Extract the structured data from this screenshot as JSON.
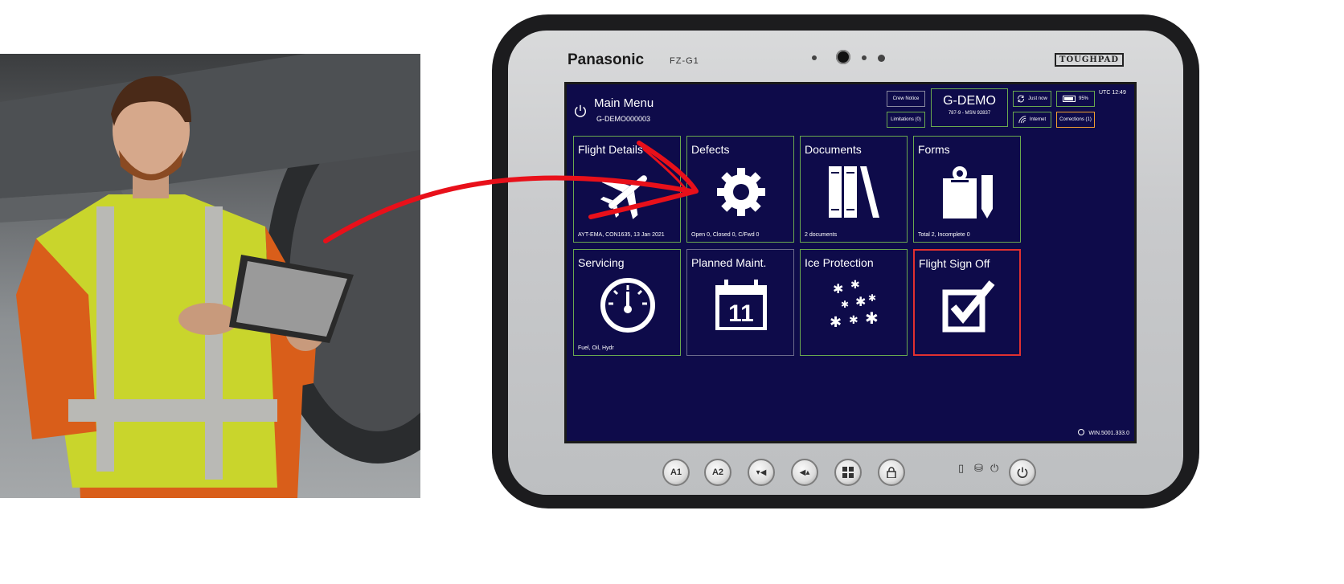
{
  "tablet": {
    "brand": "Panasonic",
    "model": "FZ-G1",
    "badge": "TOUGHPAD"
  },
  "header": {
    "title": "Main Menu",
    "subtitle": "G-DEMO000003",
    "crew_notice": "Crew Notice",
    "limitations": "Limitations (0)",
    "registration": "G-DEMO",
    "aircraft": "787-9 - MSN 92837",
    "sync_status": "Just now",
    "battery": "95%",
    "internet": "Internet",
    "corrections": "Corrections (1)",
    "utc": "UTC 12:49"
  },
  "tiles": [
    {
      "title": "Flight Details",
      "footer": "AYT-EMA,   CON1635,   13 Jan 2021",
      "icon": "airplane-icon",
      "status": "green"
    },
    {
      "title": "Defects",
      "footer": "Open 0,   Closed 0,   C/Fwd 0",
      "icon": "gear-icon",
      "status": "green"
    },
    {
      "title": "Documents",
      "footer": "2 documents",
      "icon": "books-icon",
      "status": "green"
    },
    {
      "title": "Forms",
      "footer": "Total 2,   Incomplete 0",
      "icon": "clipboard-pencil-icon",
      "status": "green"
    },
    {
      "title": "Servicing",
      "footer": "Fuel, Oil, Hydr",
      "icon": "gauge-icon",
      "status": "green"
    },
    {
      "title": "Planned Maint.",
      "footer": "",
      "icon": "calendar-icon",
      "calendar_day": "11",
      "status": "grey"
    },
    {
      "title": "Ice Protection",
      "footer": "",
      "icon": "snowflakes-icon",
      "status": "green"
    },
    {
      "title": "Flight Sign Off",
      "footer": "",
      "icon": "checkbox-icon",
      "status": "red"
    }
  ],
  "version": "WIN.5001.333.0",
  "hardware_buttons": [
    "A1",
    "A2",
    "vol-down",
    "vol-up",
    "windows",
    "rotate-lock"
  ],
  "colors": {
    "screen_bg": "#0e0b4a",
    "tile_green": "#6aa84f",
    "tile_red": "#e03030",
    "arrow": "#e8101a"
  }
}
